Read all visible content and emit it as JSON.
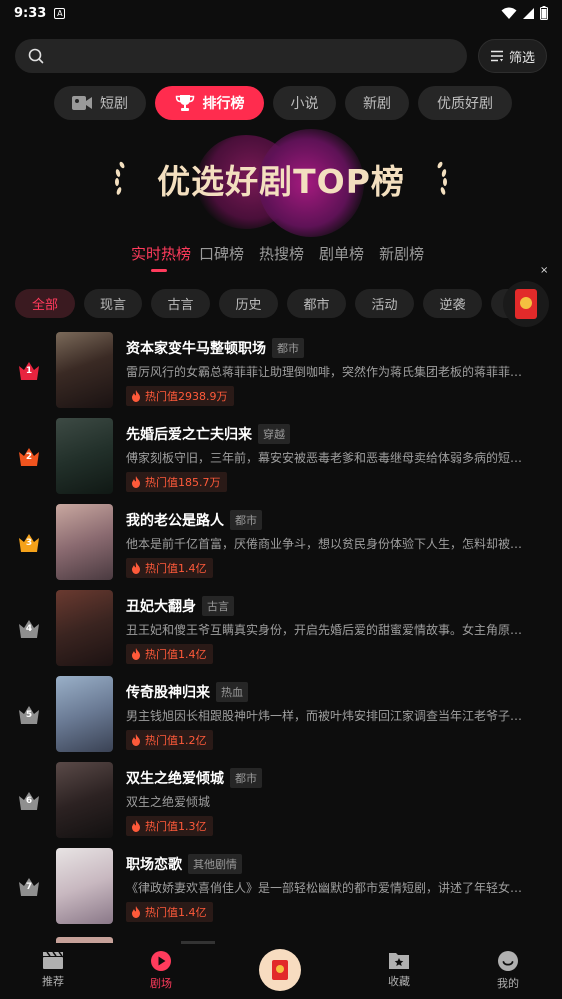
{
  "status_bar": {
    "time": "9:33",
    "notification": "A"
  },
  "search": {
    "placeholder": "",
    "filter_label": "筛选"
  },
  "top_tabs": [
    {
      "label": "短剧",
      "icon": "video-camera-icon",
      "active": false
    },
    {
      "label": "排行榜",
      "icon": "trophy-icon",
      "active": true
    },
    {
      "label": "小说",
      "active": false
    },
    {
      "label": "新剧",
      "active": false
    },
    {
      "label": "优质好剧",
      "active": false
    }
  ],
  "banner": {
    "title": "优选好剧TOP榜"
  },
  "sub_tabs": [
    {
      "label": "实时热榜",
      "active": true
    },
    {
      "label": "口碑榜",
      "active": false
    },
    {
      "label": "热搜榜",
      "active": false
    },
    {
      "label": "剧单榜",
      "active": false
    },
    {
      "label": "新剧榜",
      "active": false
    }
  ],
  "genres": [
    {
      "label": "全部",
      "active": true
    },
    {
      "label": "现言",
      "active": false
    },
    {
      "label": "古言",
      "active": false
    },
    {
      "label": "历史",
      "active": false
    },
    {
      "label": "都市",
      "active": false
    },
    {
      "label": "活动",
      "active": false
    },
    {
      "label": "逆袭",
      "active": false
    },
    {
      "label": "言",
      "active": false
    }
  ],
  "close_label": "×",
  "dramas": [
    {
      "rank": "1",
      "title": "资本家变牛马整顿职场",
      "tag": "都市",
      "desc": "雷厉风行的女霸总蒋菲菲让助理倒咖啡，突然作为蒋氏集团老板的蒋菲菲…",
      "hot": "热门值2938.9万"
    },
    {
      "rank": "2",
      "title": "先婚后爱之亡夫归来",
      "tag": "穿越",
      "desc": "傅家刻板守旧，三年前，幕安安被恶毒老爹和恶毒继母卖给体弱多病的短…",
      "hot": "热门值185.7万"
    },
    {
      "rank": "3",
      "title": "我的老公是路人",
      "tag": "都市",
      "desc": "他本是前千亿首富，厌倦商业争斗，想以贫民身份体验下人生，怎料却被…",
      "hot": "热门值1.4亿"
    },
    {
      "rank": "4",
      "title": "丑妃大翻身",
      "tag": "古言",
      "desc": "丑王妃和傻王爷互瞒真实身份，开启先婚后爱的甜蜜爱情故事。女主角原…",
      "hot": "热门值1.4亿"
    },
    {
      "rank": "5",
      "title": "传奇股神归来",
      "tag": "热血",
      "desc": "男主钱旭因长相跟股神叶炜一样，而被叶炜安排回江家调查当年江老爷子…",
      "hot": "热门值1.2亿"
    },
    {
      "rank": "6",
      "title": "双生之绝爱倾城",
      "tag": "都市",
      "desc": "双生之绝爱倾城",
      "hot": "热门值1.3亿"
    },
    {
      "rank": "7",
      "title": "职场恋歌",
      "tag": "其他剧情",
      "desc": "《律政娇妻欢喜俏佳人》是一部轻松幽默的都市爱情短剧，讲述了年轻女…",
      "hot": "热门值1.4亿"
    }
  ],
  "bottom_nav": [
    {
      "label": "推荐",
      "icon": "clapperboard-icon",
      "active": false
    },
    {
      "label": "剧场",
      "icon": "play-circle-icon",
      "active": true
    },
    {
      "label": "",
      "icon": "red-envelope-icon",
      "active": false
    },
    {
      "label": "收藏",
      "icon": "star-folder-icon",
      "active": false
    },
    {
      "label": "我的",
      "icon": "smiley-icon",
      "active": false
    }
  ],
  "colors": {
    "accent": "#ff2c4e",
    "rank1": "#e8243f",
    "rank2": "#f0541e",
    "rank3": "#f5a21a",
    "rank_other": "#8f8f8f",
    "hot_text": "#ff5a3a",
    "banner_title": "#f3dfbf"
  }
}
